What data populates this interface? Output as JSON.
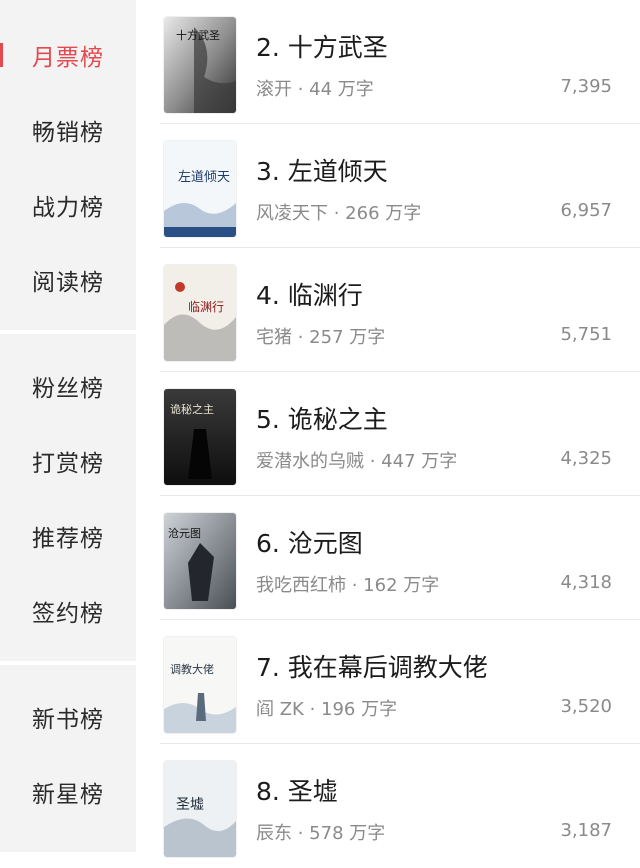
{
  "sidebar": {
    "groups": [
      [
        "月票榜",
        "畅销榜",
        "战力榜",
        "阅读榜"
      ],
      [
        "粉丝榜",
        "打赏榜",
        "推荐榜",
        "签约榜"
      ],
      [
        "新书榜",
        "新星榜"
      ]
    ],
    "items": [
      "月票榜",
      "畅销榜",
      "战力榜",
      "阅读榜",
      "粉丝榜",
      "打赏榜",
      "推荐榜",
      "签约榜",
      "新书榜",
      "新星榜"
    ],
    "active_index": 0,
    "accent_color": "#e34a4f"
  },
  "books": [
    {
      "rank_title": "2. 十方武圣",
      "author": "滚开",
      "words": "44 万字",
      "count": "7,395",
      "cover_text": "十方武圣"
    },
    {
      "rank_title": "3. 左道倾天",
      "author": "风凌天下",
      "words": "266 万字",
      "count": "6,957",
      "cover_text": "左道倾天"
    },
    {
      "rank_title": "4. 临渊行",
      "author": "宅猪",
      "words": "257 万字",
      "count": "5,751",
      "cover_text": "临渊行"
    },
    {
      "rank_title": "5. 诡秘之主",
      "author": "爱潜水的乌贼",
      "words": "447 万字",
      "count": "4,325",
      "cover_text": "诡秘之主"
    },
    {
      "rank_title": "6. 沧元图",
      "author": "我吃西红柿",
      "words": "162 万字",
      "count": "4,318",
      "cover_text": "沧元图"
    },
    {
      "rank_title": "7. 我在幕后调教大佬",
      "author": "阎 ZK",
      "words": "196 万字",
      "count": "3,520",
      "cover_text": "调教大佬"
    },
    {
      "rank_title": "8. 圣墟",
      "author": "辰东",
      "words": "578 万字",
      "count": "3,187",
      "cover_text": "圣墟"
    }
  ],
  "meta_separator": " · "
}
